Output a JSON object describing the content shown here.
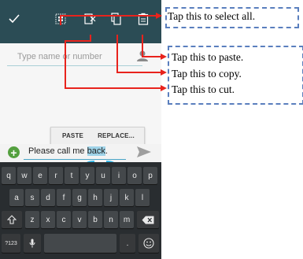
{
  "action_bar": {
    "icons": [
      "check-icon",
      "select-all-icon",
      "cut-icon",
      "copy-icon",
      "paste-icon"
    ]
  },
  "recipient": {
    "placeholder": "Type name or number"
  },
  "popup": {
    "paste_label": "PASTE",
    "replace_label": "REPLACE..."
  },
  "message": {
    "text_before": "Please call me ",
    "text_selected": "back",
    "text_after": "."
  },
  "keyboard": {
    "row1": [
      "q",
      "w",
      "e",
      "r",
      "t",
      "y",
      "u",
      "i",
      "o",
      "p"
    ],
    "row2": [
      "a",
      "s",
      "d",
      "f",
      "g",
      "h",
      "j",
      "k",
      "l"
    ],
    "row3": [
      "z",
      "x",
      "c",
      "v",
      "b",
      "n",
      "m"
    ],
    "symbols_label": "?123",
    "period_label": "."
  },
  "annotations": {
    "select_all": "Tap this to select all.",
    "paste": "Tap this to paste.",
    "copy": "Tap this to copy.",
    "cut": "Tap this to cut."
  },
  "colors": {
    "action_bar": "#2b4c55",
    "arrow": "#e8231d",
    "callout_border": "#5a7fbe",
    "selection": "#9fd3e8",
    "add_button": "#54a03f"
  }
}
